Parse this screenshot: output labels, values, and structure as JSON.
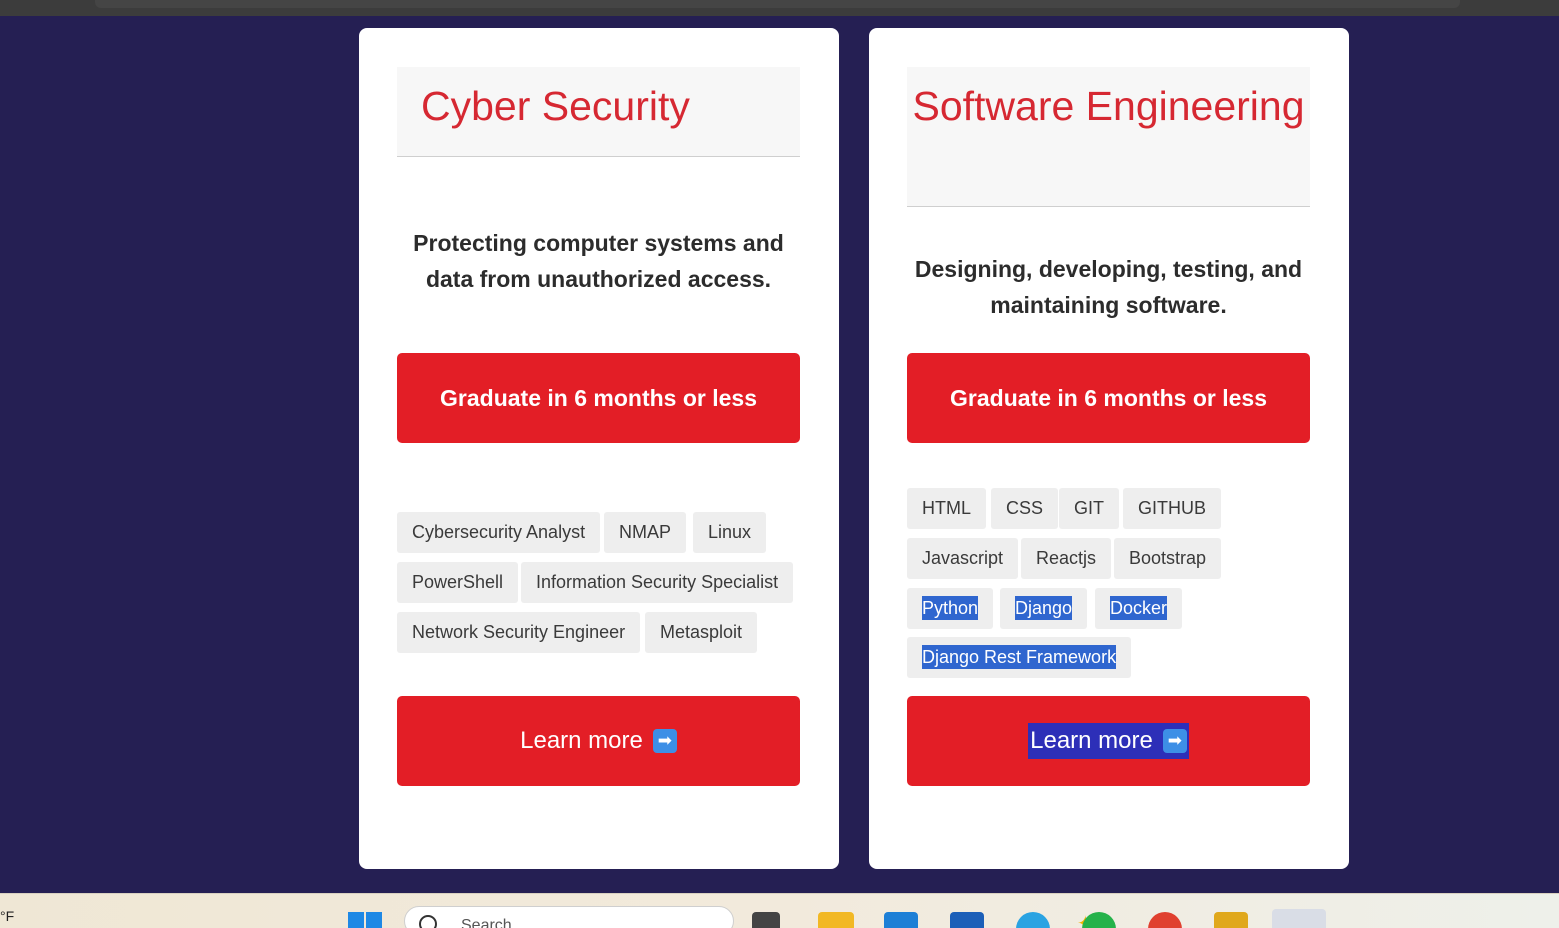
{
  "cards": {
    "cyber": {
      "title": "Cyber Security",
      "description": "Protecting computer systems and data from unauthorized access.",
      "cta": "Graduate in 6 months or less",
      "tags": [
        "Cybersecurity Analyst",
        "NMAP",
        "Linux",
        "PowerShell",
        "Information Security Specialist",
        "Network Security Engineer",
        "Metasploit"
      ],
      "learn_more": "Learn more",
      "learn_more_icon": "right-arrow-emoji"
    },
    "software": {
      "title": "Software Engineering",
      "description": "Designing, developing, testing, and maintaining software.",
      "cta": "Graduate in 6 months or less",
      "tags": [
        "HTML",
        "CSS",
        "GIT",
        "GITHUB",
        "Javascript",
        "Reactjs",
        "Bootstrap",
        "Python",
        "Django",
        "Docker",
        "Django Rest Framework"
      ],
      "selected_tags": [
        "Python",
        "Django",
        "Docker",
        "Django Rest Framework"
      ],
      "learn_more": "Learn more",
      "learn_more_icon": "right-arrow-emoji"
    }
  },
  "taskbar": {
    "temperature_unit": "°F",
    "search_placeholder": "Search",
    "apps": [
      "windows-start",
      "task-view",
      "file-explorer",
      "vscode",
      "microsoft-store",
      "telegram",
      "whatsapp",
      "chrome",
      "sublime",
      "chrome-profile"
    ]
  },
  "colors": {
    "background": "#251f53",
    "accent_red": "#e31e26",
    "title_red": "#d62832",
    "selection_blue": "#2f66cf"
  }
}
